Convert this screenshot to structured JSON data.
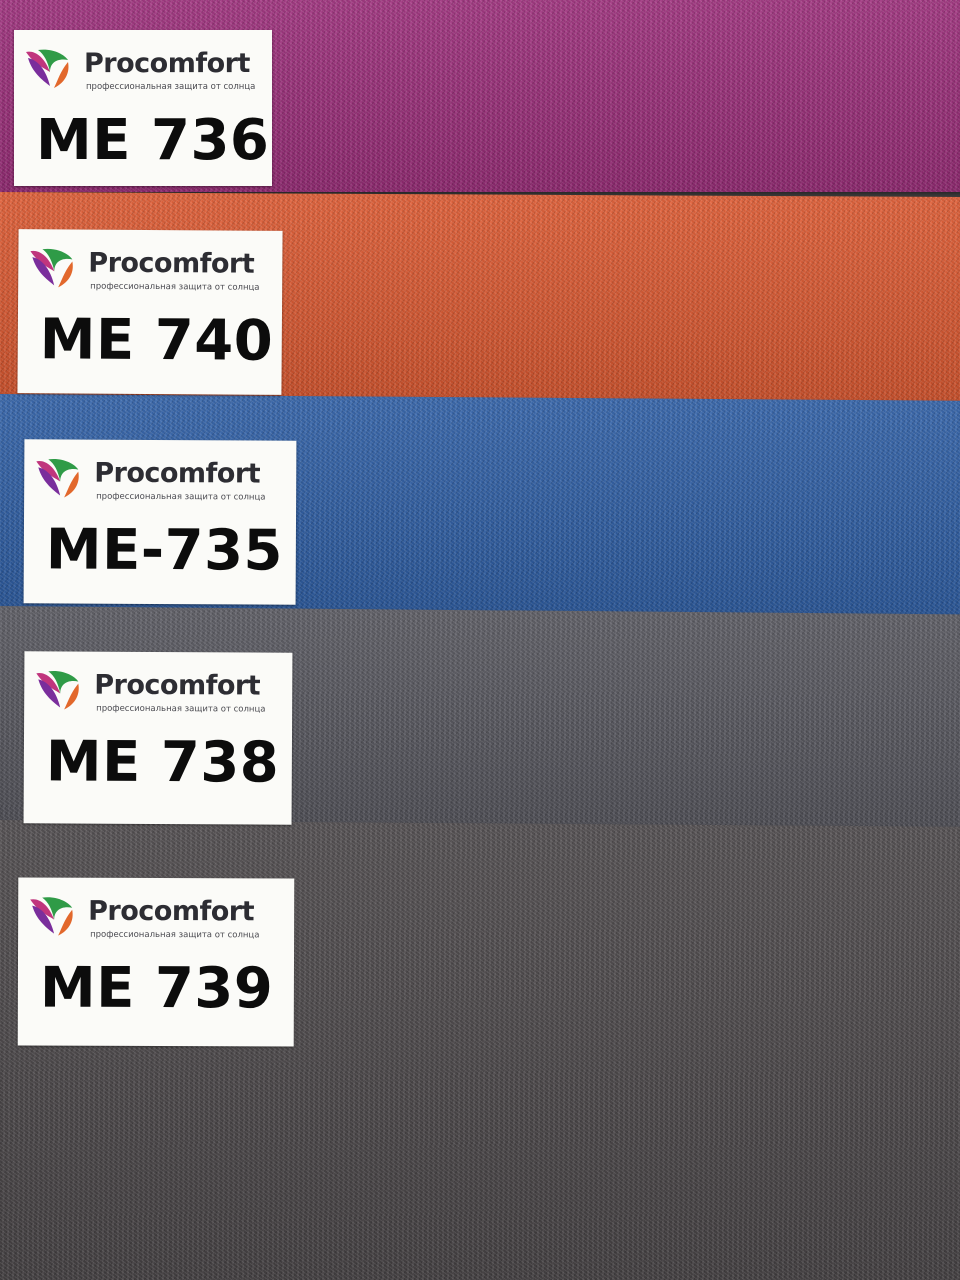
{
  "brand": {
    "name": "Procomfort",
    "tagline": "профессиональная защита от солнца",
    "logo_colors": [
      "#c0357d",
      "#7a2e9c",
      "#2f9b47",
      "#e2682c"
    ]
  },
  "swatches": [
    {
      "code": "ME 736",
      "color": "#9c2d7a"
    },
    {
      "code": "ME 740",
      "color": "#dd5930"
    },
    {
      "code": "ME-735",
      "color": "#2e5fa6"
    },
    {
      "code": "ME 738",
      "color": "#56565e"
    },
    {
      "code": "ME 739",
      "color": "#4b4749"
    }
  ]
}
